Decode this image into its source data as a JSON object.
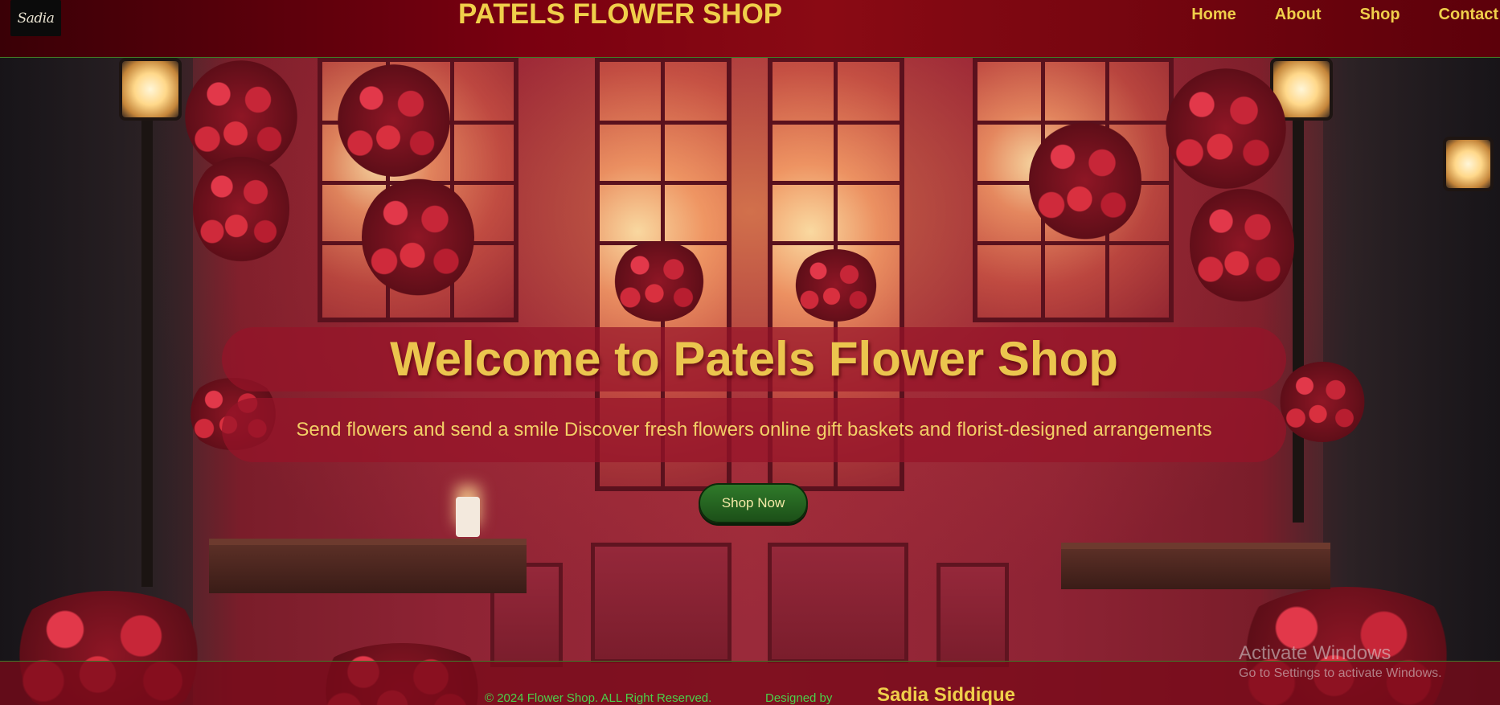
{
  "header": {
    "logo_text": "Sadia",
    "site_title": "PATELS FLOWER SHOP",
    "nav": [
      {
        "label": "Home"
      },
      {
        "label": "About"
      },
      {
        "label": "Shop"
      },
      {
        "label": "Contact"
      }
    ]
  },
  "hero": {
    "title": "Welcome to Patels Flower Shop",
    "subtitle": "Send flowers and send a smile Discover fresh flowers online gift baskets and florist-designed arrangements",
    "cta_label": "Shop Now"
  },
  "footer": {
    "copyright": "© 2024 Flower Shop. ALL Right Reserved.",
    "designed_by_label": "Designed by",
    "designer_name": "Sadia Siddique"
  },
  "watermark": {
    "title": "Activate Windows",
    "subtitle": "Go to Settings to activate Windows."
  },
  "colors": {
    "accent_gold": "#f0cf4a",
    "header_red": "#7a0010",
    "button_green": "#2f7a2a",
    "footer_green_text": "#4ad14a"
  }
}
